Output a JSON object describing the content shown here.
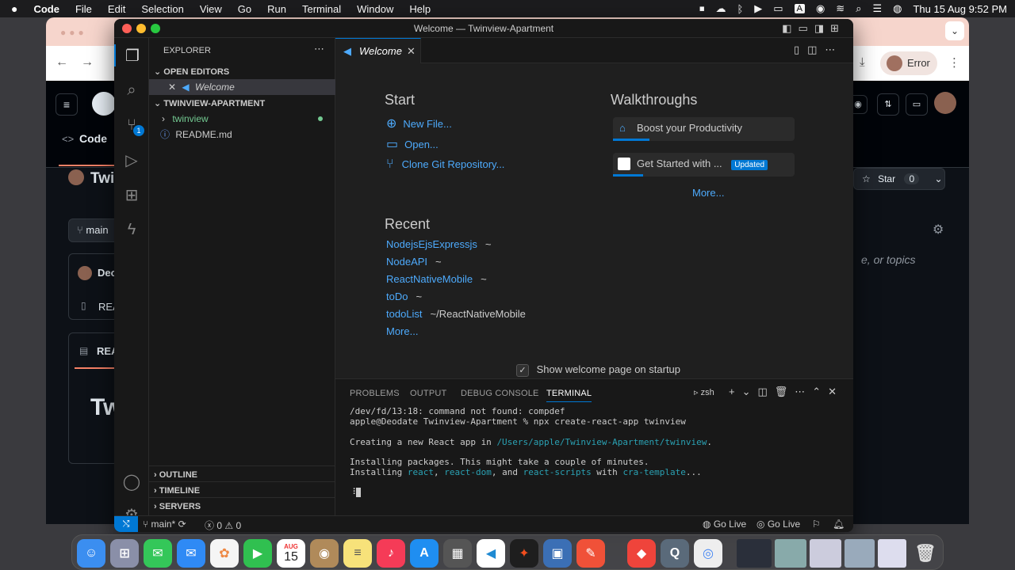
{
  "menubar": {
    "apple": "",
    "app": "Code",
    "items": [
      "File",
      "Edit",
      "Selection",
      "View",
      "Go",
      "Run",
      "Terminal",
      "Window",
      "Help"
    ],
    "datetime": "Thu 15 Aug  9:52 PM",
    "input_source": "A"
  },
  "browser": {
    "error_label": "Error",
    "gh": {
      "code_tab": "Code",
      "repo_partial": "Twi",
      "branch_partial": "main",
      "star_label": "Star",
      "star_count": "0",
      "commit_partial": "Deo",
      "file_partial": "REA",
      "readme_partial": "REA",
      "readme_big": "Tw",
      "search_hint": "e, or topics"
    }
  },
  "vscode": {
    "window_title": "Welcome — Twinview-Apartment",
    "sidebar": {
      "title": "EXPLORER",
      "open_editors": "OPEN EDITORS",
      "open_file": "Welcome",
      "folder": "TWINVIEW-APARTMENT",
      "items": [
        {
          "name": "twinview"
        },
        {
          "name": "README.md"
        }
      ],
      "outline": "OUTLINE",
      "timeline": "TIMELINE",
      "servers": "SERVERS",
      "scm_badge": "1"
    },
    "tab": {
      "label": "Welcome"
    },
    "welcome": {
      "start_heading": "Start",
      "start_actions": [
        "New File...",
        "Open...",
        "Clone Git Repository..."
      ],
      "recent_heading": "Recent",
      "recent": [
        {
          "name": "NodejsEjsExpressjs",
          "path": "~"
        },
        {
          "name": "NodeAPI",
          "path": "~"
        },
        {
          "name": "ReactNativeMobile",
          "path": "~"
        },
        {
          "name": "toDo",
          "path": "~"
        },
        {
          "name": "todoList",
          "path": "~/ReactNativeMobile"
        }
      ],
      "recent_more": "More...",
      "walk_heading": "Walkthroughs",
      "walk": [
        {
          "label": "Boost your Productivity",
          "progress": 0.2
        },
        {
          "label": "Get Started with ...",
          "badge": "Updated",
          "progress": 0.15
        }
      ],
      "walk_more": "More...",
      "startup_checkbox": "Show welcome page on startup",
      "startup_checked": true
    },
    "panel": {
      "tabs": [
        "PROBLEMS",
        "OUTPUT",
        "DEBUG CONSOLE",
        "TERMINAL"
      ],
      "active_tab": "TERMINAL",
      "shell": "zsh",
      "terminal": {
        "l1": "/dev/fd/13:18: command not found: compdef",
        "l2_prompt": "apple@Deodate Twinview-Apartment % ",
        "l2_cmd": "npx create-react-app twinview",
        "l3a": "Creating a new React app in ",
        "l3b": "/Users/apple/Twinview-Apartment/twinview",
        "l3c": ".",
        "l4": "Installing packages. This might take a couple of minutes.",
        "l5a": "Installing ",
        "l5b": "react",
        "l5c": ", ",
        "l5d": "react-dom",
        "l5e": ", and ",
        "l5f": "react-scripts",
        "l5g": " with ",
        "l5h": "cra-template",
        "l5i": "...",
        "spinner": "⠸"
      }
    },
    "status": {
      "branch": "main*",
      "errors": "0",
      "warnings": "0",
      "golive1": "Go Live",
      "golive2": "Go Live"
    }
  },
  "dock": {
    "calendar_month": "AUG",
    "calendar_day": "15"
  }
}
